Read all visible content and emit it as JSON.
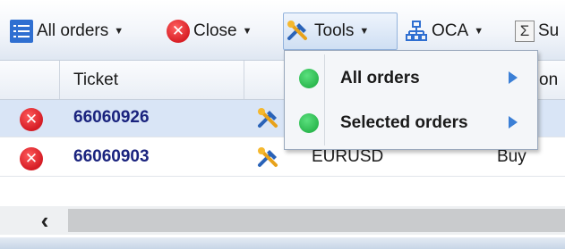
{
  "toolbar": {
    "all_orders": {
      "label": "All orders",
      "icon": "list-icon"
    },
    "close": {
      "label": "Close",
      "icon": "close-circle-icon"
    },
    "tools": {
      "label": "Tools",
      "icon": "tools-icon",
      "active": true
    },
    "oca": {
      "label": "OCA",
      "icon": "oca-tree-icon"
    },
    "next": {
      "label": "Su",
      "icon": "sigma-icon"
    }
  },
  "grid": {
    "headers": {
      "ticket": "Ticket",
      "partial_right": "on"
    },
    "rows": [
      {
        "ticket": "66060926",
        "symbol": "",
        "side": "",
        "selected": true
      },
      {
        "ticket": "66060903",
        "symbol": "EURUSD",
        "side": "Buy",
        "selected": false
      }
    ]
  },
  "tools_menu": {
    "items": [
      {
        "label": "All orders",
        "bullet_color": "#2eba52"
      },
      {
        "label": "Selected orders",
        "bullet_color": "#2eba52"
      }
    ]
  },
  "colors": {
    "accent": "#2f6fd1",
    "close_red": "#d81f26",
    "ticket_text": "#1a237e",
    "selected_row": "#d9e5f6"
  }
}
